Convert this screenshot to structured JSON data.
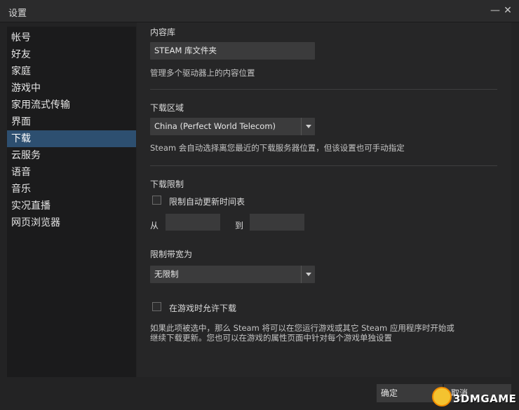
{
  "window": {
    "title": "设置",
    "minimize_icon": "minimize-icon",
    "close_icon": "close-icon"
  },
  "sidebar": {
    "items": [
      {
        "label": "帐号",
        "active": false
      },
      {
        "label": "好友",
        "active": false
      },
      {
        "label": "家庭",
        "active": false
      },
      {
        "label": "游戏中",
        "active": false
      },
      {
        "label": "家用流式传输",
        "active": false
      },
      {
        "label": "界面",
        "active": false
      },
      {
        "label": "下载",
        "active": true
      },
      {
        "label": "云服务",
        "active": false
      },
      {
        "label": "语音",
        "active": false
      },
      {
        "label": "音乐",
        "active": false
      },
      {
        "label": "实况直播",
        "active": false
      },
      {
        "label": "网页浏览器",
        "active": false
      }
    ],
    "active_color": "#2d4f70"
  },
  "content_library": {
    "heading": "内容库",
    "button_label": "STEAM 库文件夹",
    "description": "管理多个驱动器上的内容位置"
  },
  "download_region": {
    "heading": "下载区域",
    "selected": "China (Perfect World Telecom)",
    "description": "Steam 会自动选择离您最近的下载服务器位置，但该设置也可手动指定"
  },
  "download_limits": {
    "heading": "下载限制",
    "schedule_checkbox_label": "限制自动更新时间表",
    "schedule_checked": false,
    "from_label": "从",
    "to_label": "到",
    "from_value": "",
    "to_value": "",
    "bandwidth_label": "限制带宽为",
    "bandwidth_selected": "无限制",
    "ingame_checkbox_label": "在游戏时允许下载",
    "ingame_checked": false,
    "ingame_description_line1": "如果此项被选中，那么 Steam 将可以在您运行游戏或其它 Steam 应用程序时开始或",
    "ingame_description_line2": "继续下载更新。您也可以在游戏的属性页面中针对每个游戏单独设置"
  },
  "footer": {
    "ok_label": "确定",
    "cancel_label": "取消"
  },
  "watermark": {
    "text": "3DMGAME"
  }
}
